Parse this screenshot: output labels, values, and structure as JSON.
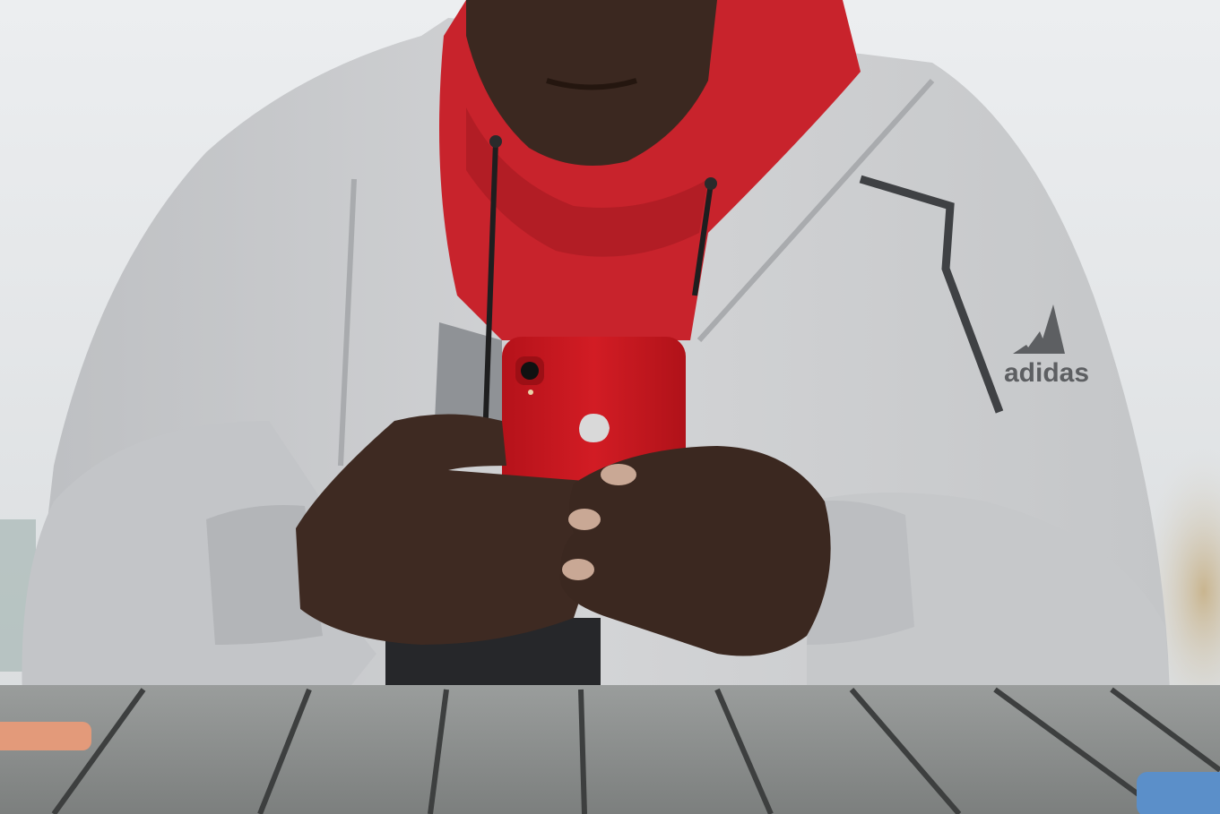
{
  "scene": {
    "brand_wordmark": "adidas",
    "colors": {
      "background": "#e3e6e8",
      "jacket": "#c9cacc",
      "jacket_shadow": "#aeb0b3",
      "hoodie": "#c8232c",
      "skin": "#3b2820",
      "phone": "#c9171f",
      "table": "#8a8d8c",
      "table_gap": "#3d3f3f",
      "side_phone_left": "#e39a7a",
      "side_phone_right": "#5b8fc9"
    }
  }
}
